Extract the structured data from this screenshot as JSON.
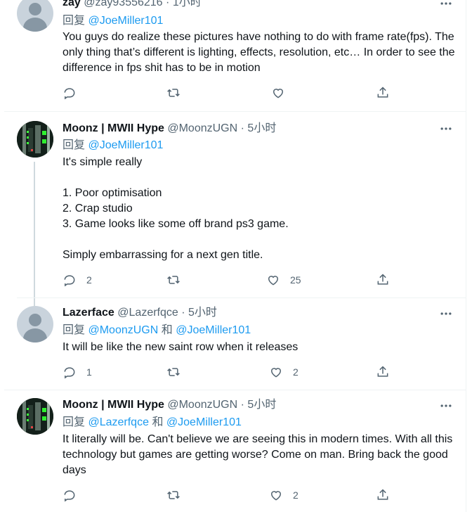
{
  "tweets": [
    {
      "name": "zay",
      "handle": "@zay93556216",
      "time": "1小时",
      "reply_prefix": "回复",
      "mentions": [
        "@JoeMiller101"
      ],
      "joiner": "",
      "text": "You guys do realize these pictures have nothing to do with frame rate(fps). The only thing that’s different is lighting, effects, resolution, etc… In order to see the difference in fps shit has to be in motion",
      "stats": {
        "reply": "",
        "retweet": "",
        "like": ""
      }
    },
    {
      "name": "Moonz | MWII Hype",
      "handle": "@MoonzUGN",
      "time": "5小时",
      "reply_prefix": "回复",
      "mentions": [
        "@JoeMiller101"
      ],
      "joiner": "",
      "text": "It's simple really\n\n1. Poor optimisation\n2. Crap studio\n3. Game looks like some off brand ps3 game.\n\nSimply embarrassing for a next gen title.",
      "stats": {
        "reply": "2",
        "retweet": "",
        "like": "25"
      }
    },
    {
      "name": "Lazerface",
      "handle": "@Lazerfqce",
      "time": "5小时",
      "reply_prefix": "回复",
      "mentions": [
        "@MoonzUGN",
        "@JoeMiller101"
      ],
      "joiner": "和",
      "text": "It will be like the new saint row when it releases",
      "stats": {
        "reply": "1",
        "retweet": "",
        "like": "2"
      }
    },
    {
      "name": "Moonz | MWII Hype",
      "handle": "@MoonzUGN",
      "time": "5小时",
      "reply_prefix": "回复",
      "mentions": [
        "@Lazerfqce",
        "@JoeMiller101"
      ],
      "joiner": "和",
      "text": "It literally will be. Can't believe we are seeing this in modern times. With all this technology but games are getting worse? Come on man. Bring back the good days",
      "stats": {
        "reply": "",
        "retweet": "",
        "like": "2"
      }
    }
  ],
  "separator": "·",
  "icons": {
    "reply": "reply-icon",
    "retweet": "retweet-icon",
    "like": "like-icon",
    "share": "share-icon",
    "more": "more-icon"
  },
  "colors": {
    "link": "#1d9bf0",
    "muted": "#536471",
    "text": "#0f1419",
    "thread_line": "#cfd9de"
  }
}
